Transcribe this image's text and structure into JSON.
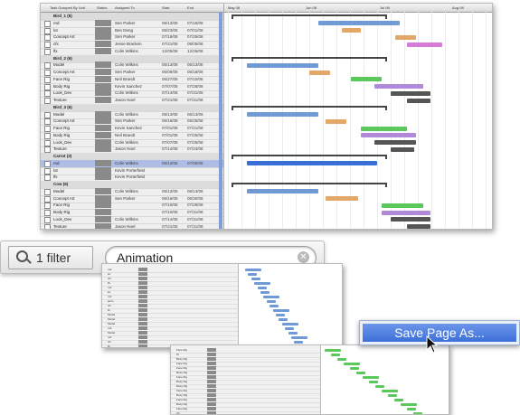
{
  "gantt_main": {
    "columns": [
      "Task Grouped By Unit",
      "Status",
      "Assigned To",
      "Start",
      "End"
    ],
    "timeline_headers": [
      "May 08",
      "Jun 08",
      "Jul 08",
      "Aug 08"
    ],
    "rows": [
      {
        "type": "group",
        "name": "Bird_1 (5)"
      },
      {
        "type": "task",
        "name": "rnd",
        "assigned": "Sen Parker",
        "start": "06/13/08",
        "end": "07/18/08"
      },
      {
        "type": "task",
        "name": "lot",
        "assigned": "Ben Deng",
        "start": "06/23/08",
        "end": "07/01/08"
      },
      {
        "type": "task",
        "name": "Concept Art",
        "assigned": "Sen Parker",
        "start": "07/16/08",
        "end": "07/25/08"
      },
      {
        "type": "task",
        "name": "cfx",
        "assigned": "Jesse Bracken",
        "start": "07/21/08",
        "end": "08/05/08"
      },
      {
        "type": "task",
        "name": "lfx",
        "assigned": "Colin Wilkins",
        "start": "12/05/08",
        "end": "12/26/08"
      },
      {
        "type": "group",
        "name": "Bird_2 (6)"
      },
      {
        "type": "task",
        "name": "Model",
        "assigned": "Colin Wilkins",
        "start": "05/13/08",
        "end": "06/13/08"
      },
      {
        "type": "task",
        "name": "Concept Art",
        "assigned": "Sen Parker",
        "start": "06/09/08",
        "end": "06/18/08"
      },
      {
        "type": "task",
        "name": "Face Rig",
        "assigned": "Neil Brandt",
        "start": "06/27/08",
        "end": "07/10/08"
      },
      {
        "type": "task",
        "name": "Body Rig",
        "assigned": "Kevin Sanchez",
        "start": "07/07/08",
        "end": "07/28/08"
      },
      {
        "type": "task",
        "name": "Look_Dev",
        "assigned": "Colin Wilkins",
        "start": "07/14/08",
        "end": "07/31/08"
      },
      {
        "type": "task",
        "name": "Texture",
        "assigned": "Jason Noel",
        "start": "07/21/08",
        "end": "07/31/08"
      },
      {
        "type": "group",
        "name": "Bird_3 (6)"
      },
      {
        "type": "task",
        "name": "Model",
        "assigned": "Colin Wilkins",
        "start": "05/13/08",
        "end": "06/13/08"
      },
      {
        "type": "task",
        "name": "Concept Art",
        "assigned": "Sen Parker",
        "start": "06/16/08",
        "end": "06/25/08"
      },
      {
        "type": "task",
        "name": "Face Rig",
        "assigned": "Kevin Sanchez",
        "start": "07/01/08",
        "end": "07/21/08"
      },
      {
        "type": "task",
        "name": "Body Rig",
        "assigned": "Neil Brandt",
        "start": "07/01/08",
        "end": "07/25/08"
      },
      {
        "type": "task",
        "name": "Look_Dev",
        "assigned": "Colin Wilkins",
        "start": "07/07/08",
        "end": "07/25/08"
      },
      {
        "type": "task",
        "name": "Texture",
        "assigned": "Jason Noel",
        "start": "07/14/08",
        "end": "07/24/08"
      },
      {
        "type": "group",
        "name": "Carrot (3)"
      },
      {
        "type": "task",
        "name": "rnd",
        "assigned": "Colin Wilkins",
        "start": "05/13/08",
        "end": "07/08/08",
        "selected": true
      },
      {
        "type": "task",
        "name": "lot",
        "assigned": "Kevin Porterfield",
        "start": "",
        "end": ""
      },
      {
        "type": "task",
        "name": "lfx",
        "assigned": "Kevin Porterfield",
        "start": "",
        "end": ""
      },
      {
        "type": "group",
        "name": "Cow (6)"
      },
      {
        "type": "task",
        "name": "Model",
        "assigned": "Colin Wilkins",
        "start": "05/13/08",
        "end": "06/13/08"
      },
      {
        "type": "task",
        "name": "Concept Art",
        "assigned": "Sen Parker",
        "start": "06/16/08",
        "end": "06/30/08"
      },
      {
        "type": "task",
        "name": "Face Rig",
        "assigned": "",
        "start": "07/10/08",
        "end": "07/28/08"
      },
      {
        "type": "task",
        "name": "Body Rig",
        "assigned": "",
        "start": "07/10/08",
        "end": "07/31/08"
      },
      {
        "type": "task",
        "name": "Look_Dev",
        "assigned": "Colin Wilkins",
        "start": "07/14/08",
        "end": "07/31/08"
      },
      {
        "type": "task",
        "name": "Texture",
        "assigned": "Jason Noel",
        "start": "07/21/08",
        "end": "07/31/08"
      }
    ]
  },
  "filter_bar": {
    "filter_button_label": "1 filter",
    "search_value": "Animation",
    "icons": [
      "search-icon",
      "clear-icon"
    ]
  },
  "context_menu": {
    "item_label": "Save Page As..."
  },
  "mini_screens": {
    "a_rows": [
      "rnd",
      "lot",
      "cfx",
      "lfx",
      "rnd",
      "lot",
      "rnd",
      "anim",
      "cfx",
      "lfx",
      "Model",
      "Model",
      "Model",
      "rnd",
      "Model",
      "rnd",
      "cfx",
      "lfx"
    ],
    "b_rows": [
      "Face Rig",
      "lfx",
      "Body Rig",
      "Face Rig",
      "Face Rig",
      "Body Rig",
      "Face Rig",
      "Body Rig",
      "Body Rig",
      "Face Rig",
      "Body Rig",
      "Face Rig",
      "Body Rig",
      "Face Rig",
      "cfx"
    ]
  },
  "colors": {
    "bar_blue": "#6f9ad6",
    "bar_orange": "#e3a767",
    "bar_magenta": "#d77bd8",
    "bar_green": "#5ac85a",
    "bar_purple": "#b08ad9",
    "bar_dark": "#555555",
    "selection": "#3a6fd8"
  }
}
